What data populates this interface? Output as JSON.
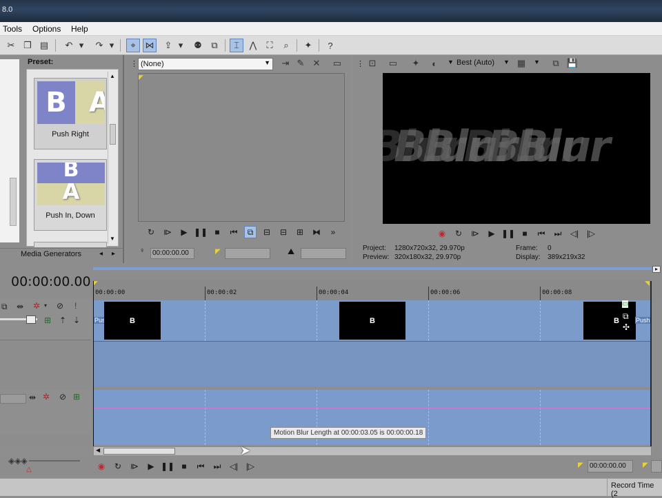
{
  "window": {
    "title": "8.0"
  },
  "menu": {
    "items": [
      "Tools",
      "Options",
      "Help"
    ]
  },
  "transitions": {
    "preset_heading": "Preset:",
    "presets": [
      {
        "label": "Push Right",
        "letters": "B A"
      },
      {
        "label": "Push In, Down",
        "letters": "B A"
      }
    ],
    "tabs": [
      "Media Generators"
    ]
  },
  "trimmer": {
    "select_value": "(None)",
    "timecode": "00:00:00.00"
  },
  "preview": {
    "quality": "Best (Auto)",
    "video_text": "BlurBlur",
    "project_label": "Project:",
    "project_value": "1280x720x32, 29.970p",
    "preview_label": "Preview:",
    "preview_value": "320x180x32, 29.970p",
    "frame_label": "Frame:",
    "frame_value": "0",
    "display_label": "Display:",
    "display_value": "389x219x32"
  },
  "timeline": {
    "timecode": "00:00:00.00",
    "ruler": [
      "00:00:00",
      "00:00:02",
      "00:00:04",
      "00:00:06",
      "00:00:08"
    ],
    "clip_letter": "B",
    "clip_tag": "Push",
    "tooltip": "Motion Blur Length at 00:00:03.05 is 00:00:00.18",
    "end_timecode": "00:00:00.00",
    "record_time": "Record Time (2"
  },
  "colors": {
    "track": "#7b9ccb",
    "record": "#c0282f",
    "selection": "#a8c2e6"
  }
}
